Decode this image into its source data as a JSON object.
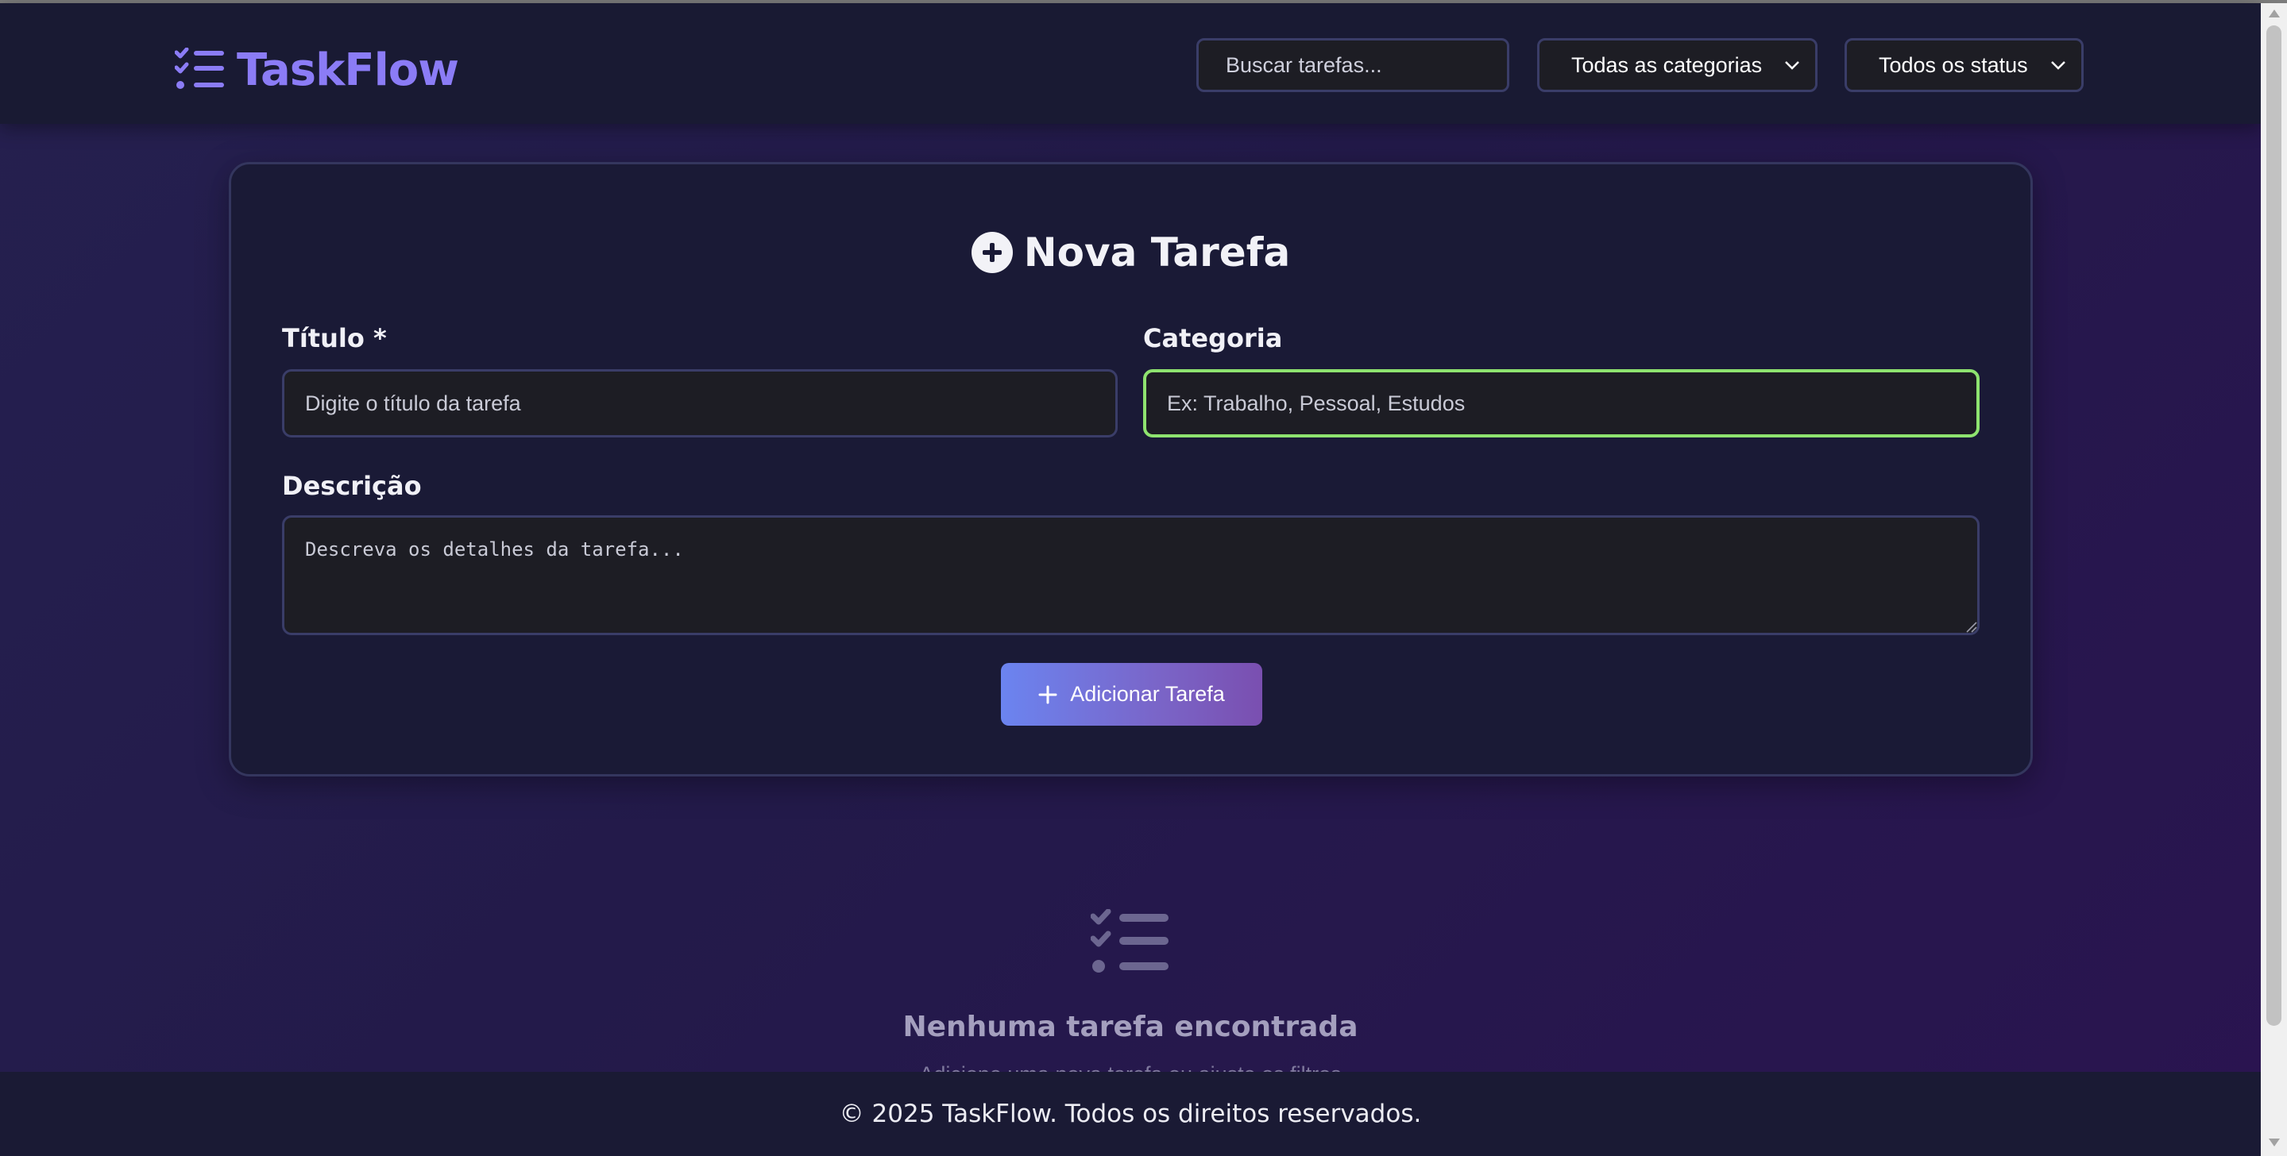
{
  "app": {
    "name": "TaskFlow",
    "logo_icon": "task-list-icon",
    "accent_color": "#8b7cf6"
  },
  "header": {
    "search": {
      "placeholder": "Buscar tarefas...",
      "value": ""
    },
    "category_filter": {
      "selected": "Todas as categorias",
      "icon": "chevron-down-icon"
    },
    "status_filter": {
      "selected": "Todos os status",
      "icon": "chevron-down-icon"
    }
  },
  "form": {
    "title": "Nova Tarefa",
    "title_icon": "plus-circle-icon",
    "fields": {
      "titulo": {
        "label": "Título *",
        "placeholder": "Digite o título da tarefa",
        "value": ""
      },
      "categoria": {
        "label": "Categoria",
        "placeholder": "Ex: Trabalho, Pessoal, Estudos",
        "value": "",
        "focused": true,
        "focus_color": "#8ee36f"
      },
      "descricao": {
        "label": "Descrição",
        "placeholder": "Descreva os detalhes da tarefa...",
        "value": ""
      }
    },
    "submit_label": "Adicionar Tarefa",
    "submit_icon": "plus-icon"
  },
  "empty_state": {
    "icon": "task-list-icon",
    "title": "Nenhuma tarefa encontrada",
    "subtitle": "Adicione uma nova tarefa ou ajuste os filtros"
  },
  "footer": {
    "text": "© 2025 TaskFlow. Todos os direitos reservados."
  }
}
